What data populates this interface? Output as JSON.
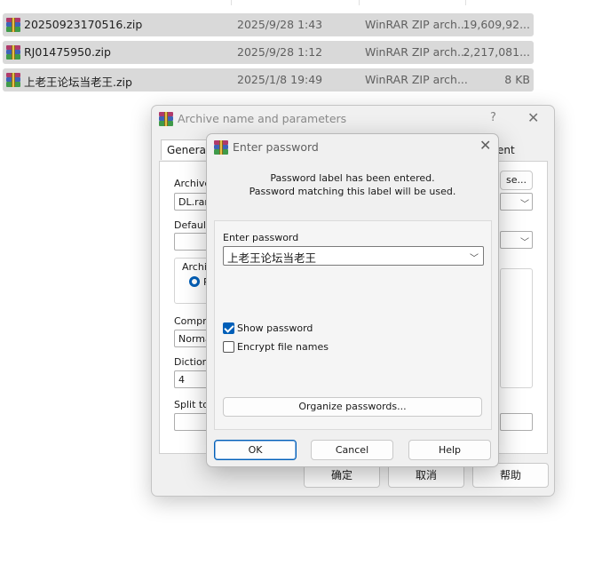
{
  "file_list": {
    "files": [
      {
        "name": "20250923170516.zip",
        "modified": "2025/9/28 1:43",
        "type": "WinRAR ZIP arch...",
        "size": "19,609,92..."
      },
      {
        "name": "RJ01475950.zip",
        "modified": "2025/9/28 1:12",
        "type": "WinRAR ZIP arch...",
        "size": "2,217,081..."
      },
      {
        "name": "上老王论坛当老王.zip",
        "modified": "2025/1/8 19:49",
        "type": "WinRAR ZIP arch...",
        "size": "8 KB"
      }
    ]
  },
  "archive_dialog": {
    "title": "Archive name and parameters",
    "help_glyph": "?",
    "close_glyph": "✕",
    "tabs": {
      "general": "General",
      "comment_partial": "ent"
    },
    "archive_label_partial": "Archive",
    "archive_name_partial": "DL.rar",
    "browse_partial": "se...",
    "default_label_partial": "Default",
    "archive_format_partial": "Archiv",
    "radio_partial": "R",
    "compression_label_partial": "Compre",
    "compression_value_partial": "Normal",
    "dictionary_label_partial": "Dictiona",
    "dictionary_value": "4",
    "split_label_partial": "Split to",
    "ok_button": "确定",
    "cancel_button": "取消",
    "help_button": "帮助"
  },
  "password_dialog": {
    "title": "Enter password",
    "close_glyph": "✕",
    "message_line1": "Password label has been entered.",
    "message_line2": "Password matching this label will be used.",
    "password_label": "Enter password",
    "password_value": "上老王论坛当老王",
    "show_password_label": "Show password",
    "show_password_checked": true,
    "encrypt_names_label": "Encrypt file names",
    "encrypt_names_checked": false,
    "organize_button": "Organize passwords...",
    "ok_button": "OK",
    "cancel_button": "Cancel",
    "help_button": "Help"
  },
  "colors": {
    "selection_row": "#d9d9d9",
    "accent": "#005fb8",
    "dialog_bg": "#f0f0f0"
  },
  "icons": {
    "archive_file": "winrar-archive-icon",
    "dropdown": "chevron-down-icon",
    "close": "close-icon"
  }
}
